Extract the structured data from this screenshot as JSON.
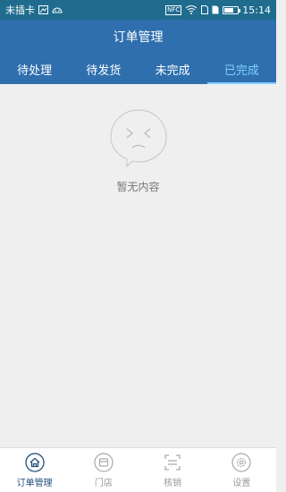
{
  "status_bar": {
    "carrier": "未插卡",
    "time": "15:14",
    "nfc_label": "NFC",
    "icons": [
      "sim-icon",
      "android-icon",
      "nfc-icon",
      "wifi-icon",
      "sim-card-icon",
      "sd-card-icon",
      "battery-icon"
    ]
  },
  "header": {
    "title": "订单管理"
  },
  "tabs": [
    {
      "label": "待处理",
      "active": false
    },
    {
      "label": "待发货",
      "active": false
    },
    {
      "label": "未完成",
      "active": false
    },
    {
      "label": "已完成",
      "active": true
    }
  ],
  "empty_state": {
    "icon": "sad-face-bubble-icon",
    "text": "暂无内容"
  },
  "bottom_nav": [
    {
      "label": "订单管理",
      "icon": "home-circle-icon",
      "active": true
    },
    {
      "label": "门店",
      "icon": "store-icon",
      "active": false
    },
    {
      "label": "核销",
      "icon": "scan-icon",
      "active": false
    },
    {
      "label": "设置",
      "icon": "gear-icon",
      "active": false
    }
  ],
  "colors": {
    "status_bar": "#1f6c8f",
    "header": "#2f6fae",
    "active_tab": "#7fd0ff",
    "background": "#efefef",
    "nav_active": "#1f4f7a",
    "nav_inactive": "#999999"
  }
}
